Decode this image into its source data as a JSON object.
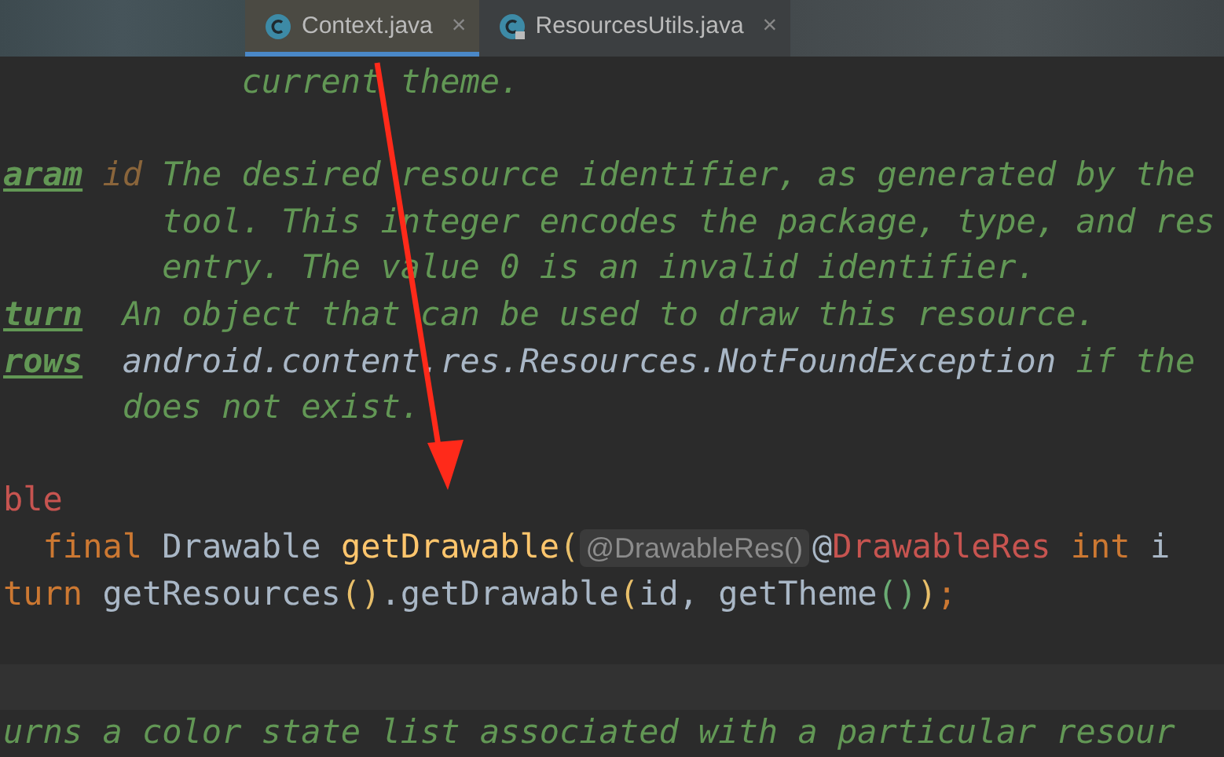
{
  "tabs": [
    {
      "label": "Context.java",
      "selected": true,
      "locked": false,
      "close": "×"
    },
    {
      "label": "ResourcesUtils.java",
      "selected": false,
      "locked": true,
      "close": "×"
    }
  ],
  "editor": {
    "lines": [
      {
        "kind": "code",
        "tokens": [
          {
            "kind": "comment",
            "text": "            current theme."
          }
        ]
      },
      {
        "kind": "code"
      },
      {
        "kind": "code",
        "tokens": [
          {
            "kind": "tag",
            "text": "aram"
          },
          {
            "kind": "param",
            "text": " id"
          },
          {
            "kind": "comment",
            "text": " The desired resource identifier, as generated by the"
          }
        ]
      },
      {
        "kind": "code",
        "tokens": [
          {
            "kind": "comment",
            "text": "        tool. This integer encodes the package, type, and res"
          }
        ]
      },
      {
        "kind": "code",
        "tokens": [
          {
            "kind": "comment",
            "text": "        entry. The value 0 is an invalid identifier."
          }
        ]
      },
      {
        "kind": "code",
        "tokens": [
          {
            "kind": "tag",
            "text": "turn"
          },
          {
            "kind": "comment",
            "text": "  An object that can be used to draw this resource."
          }
        ]
      },
      {
        "kind": "code",
        "tokens": [
          {
            "kind": "tag",
            "text": "rows"
          },
          {
            "kind": "ref",
            "text": "  android.content.res.Resources.NotFoundException"
          },
          {
            "kind": "comment",
            "text": " if the"
          }
        ]
      },
      {
        "kind": "code",
        "tokens": [
          {
            "kind": "comment",
            "text": "      does not exist."
          }
        ]
      },
      {
        "kind": "code"
      },
      {
        "kind": "code",
        "tokens": [
          {
            "kind": "annotation",
            "text": "ble"
          }
        ]
      },
      {
        "kind": "code",
        "tokens": [
          {
            "kind": "keyword",
            "text": "  final "
          },
          {
            "kind": "plain",
            "text": "Drawable "
          },
          {
            "kind": "method",
            "text": "getDrawable"
          },
          {
            "kind": "paren",
            "text": "("
          },
          {
            "kind": "hint",
            "text": "@DrawableRes()"
          },
          {
            "kind": "plain",
            "text": "@"
          },
          {
            "kind": "annotation",
            "text": "DrawableRes "
          },
          {
            "kind": "keyword",
            "text": "int "
          },
          {
            "kind": "plain",
            "text": "i"
          }
        ]
      },
      {
        "kind": "code",
        "tokens": [
          {
            "kind": "keyword",
            "text": "turn "
          },
          {
            "kind": "plain",
            "text": "getResources"
          },
          {
            "kind": "paren",
            "text": "()"
          },
          {
            "kind": "plain",
            "text": ".getDrawable"
          },
          {
            "kind": "paren",
            "text": "("
          },
          {
            "kind": "plain",
            "text": "id, getTheme"
          },
          {
            "kind": "paren2",
            "text": "()"
          },
          {
            "kind": "paren",
            "text": ")"
          },
          {
            "kind": "keyword",
            "text": ";"
          }
        ]
      },
      {
        "kind": "code"
      },
      {
        "kind": "band"
      },
      {
        "kind": "code",
        "tokens": [
          {
            "kind": "comment",
            "text": "urns a color state list associated with a particular resour"
          }
        ]
      }
    ]
  }
}
